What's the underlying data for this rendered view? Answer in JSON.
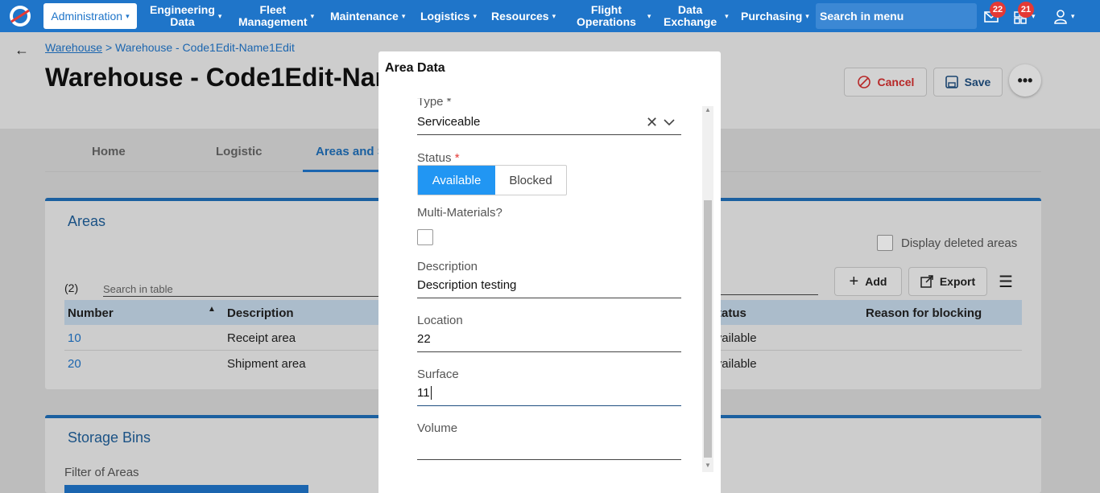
{
  "topbar": {
    "admin_label": "Administration",
    "nav": [
      {
        "line1": "Engineering",
        "line2": "Data"
      },
      {
        "line1": "Fleet",
        "line2": "Management"
      },
      {
        "line1": "Maintenance",
        "line2": ""
      },
      {
        "line1": "Logistics",
        "line2": ""
      },
      {
        "line1": "Resources",
        "line2": ""
      },
      {
        "line1": "Flight",
        "line2": "Operations"
      },
      {
        "line1": "Data",
        "line2": "Exchange"
      },
      {
        "line1": "Purchasing",
        "line2": ""
      }
    ],
    "menu_search_placeholder": "Search in menu",
    "mail_badge": "22",
    "apps_badge": "21"
  },
  "header": {
    "breadcrumb_root": "Warehouse",
    "breadcrumb_sep": " > ",
    "breadcrumb_current": "Warehouse - Code1Edit-Name1Edit",
    "title": "Warehouse - Code1Edit-Name1Edit",
    "cancel_label": "Cancel",
    "save_label": "Save",
    "more_label": "•••"
  },
  "tabs": {
    "home": "Home",
    "logistic": "Logistic",
    "areas": "Areas and Storage Bins"
  },
  "areas": {
    "title": "Areas",
    "display_deleted_label": "Display deleted areas",
    "count": "(2)",
    "search_placeholder": "Search in table",
    "add_label": "Add",
    "export_label": "Export",
    "columns": {
      "number": "Number",
      "description": "Description",
      "status": "Status",
      "reason": "Reason for blocking"
    },
    "rows": [
      {
        "number": "10",
        "description": "Receipt area",
        "status": "Available"
      },
      {
        "number": "20",
        "description": "Shipment area",
        "status": "Available"
      }
    ]
  },
  "storage": {
    "title": "Storage Bins",
    "filter_label": "Filter of Areas"
  },
  "modal": {
    "title": "Area Data",
    "type_label": "Type *",
    "type_value": "Serviceable",
    "status_label": "Status",
    "required_mark": "*",
    "status_available": "Available",
    "status_blocked": "Blocked",
    "multi_label": "Multi-Materials?",
    "description_label": "Description",
    "description_value": "Description testing",
    "location_label": "Location",
    "location_value": "22",
    "surface_label": "Surface",
    "surface_value": "11",
    "volume_label": "Volume",
    "volume_value": ""
  },
  "colors": {
    "brand": "#1f75c9",
    "accent": "#2196f3",
    "badge": "#e53935",
    "cancel": "#d32f2f"
  }
}
